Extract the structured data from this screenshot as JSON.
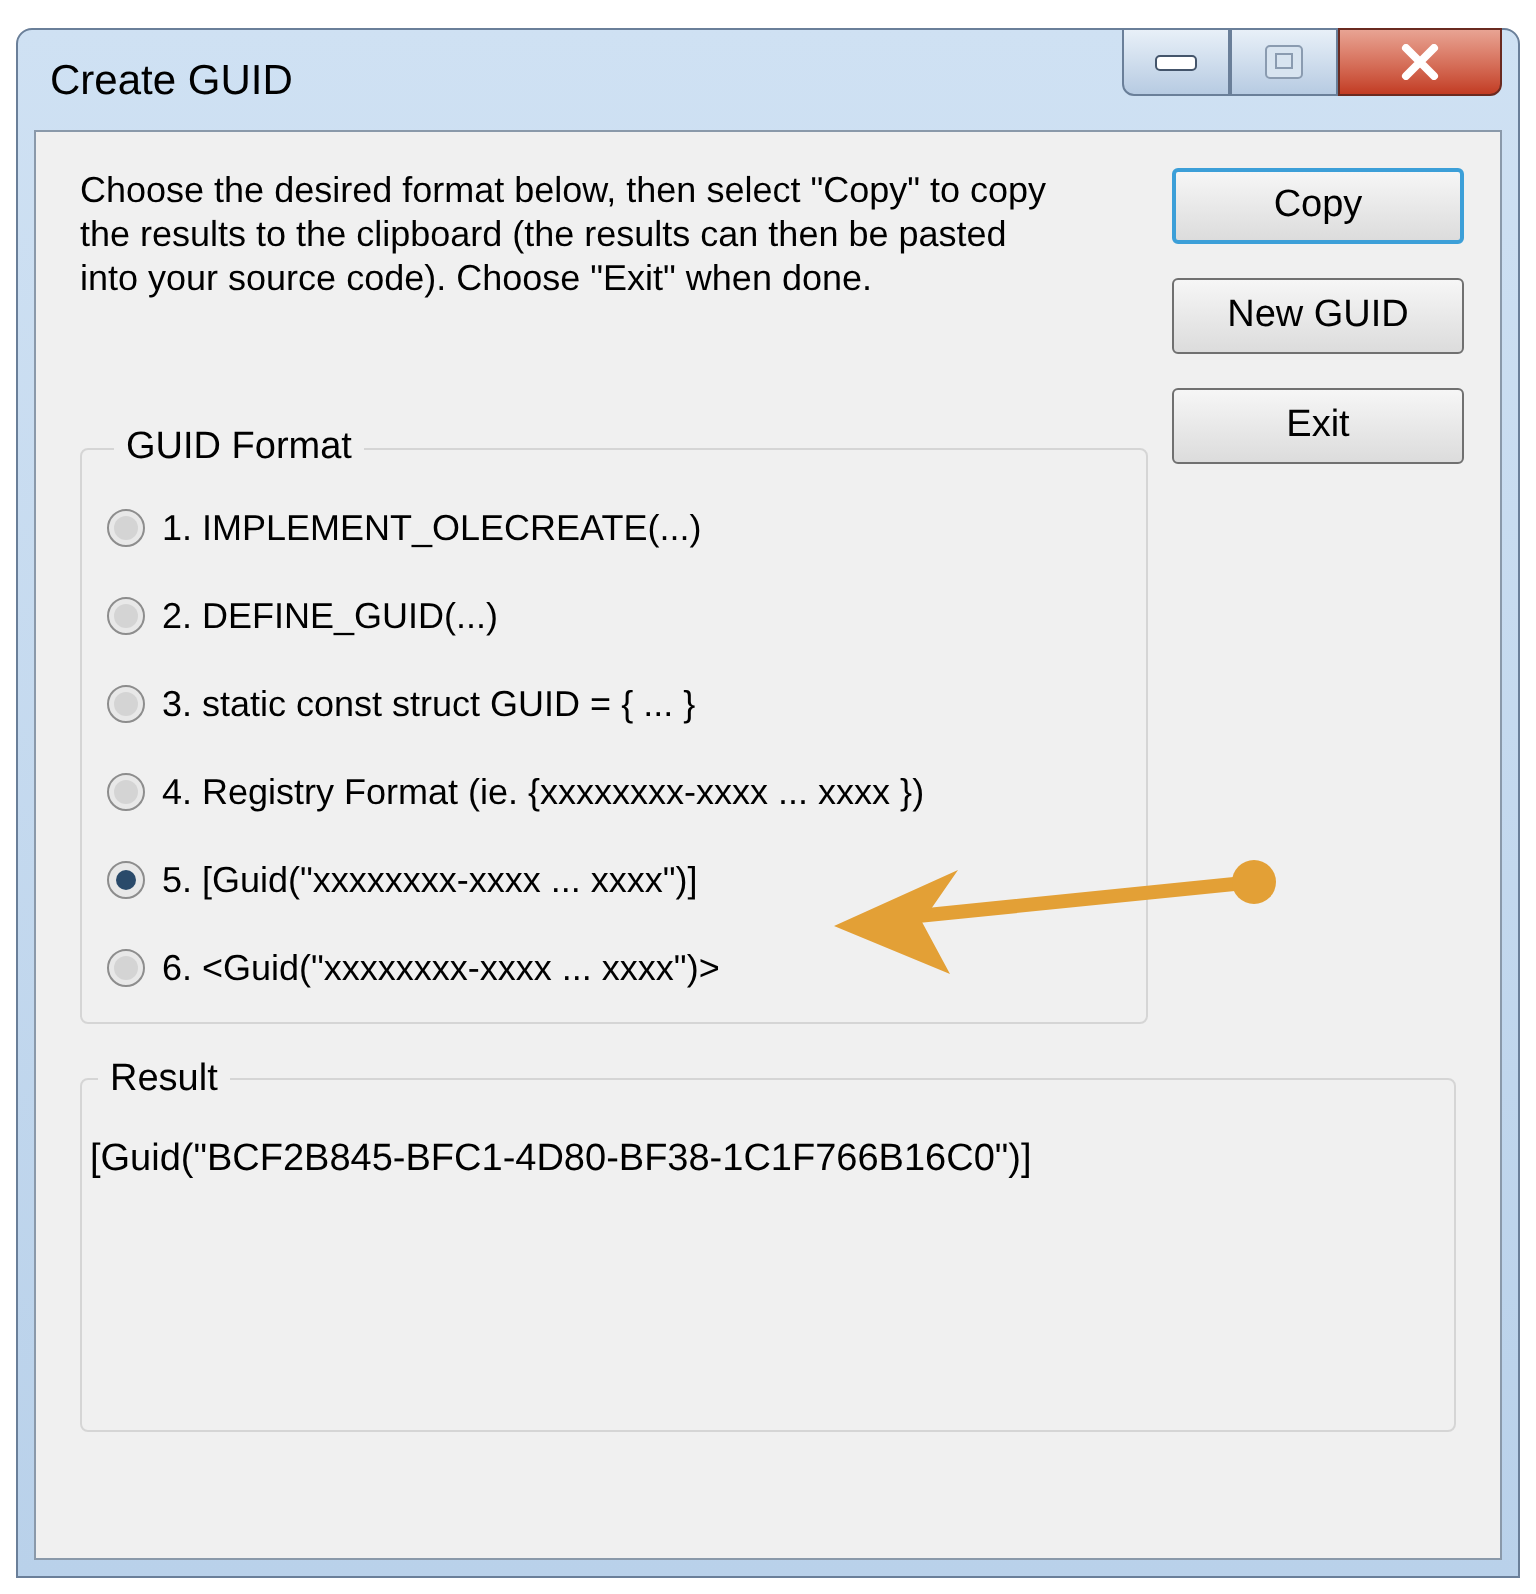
{
  "window": {
    "title": "Create GUID"
  },
  "instructions": "Choose the desired format below, then select \"Copy\" to copy the results to the clipboard (the results can then be pasted into your source code).  Choose \"Exit\" when done.",
  "buttons": [
    {
      "label": "Copy",
      "default": true
    },
    {
      "label": "New GUID",
      "default": false
    },
    {
      "label": "Exit",
      "default": false
    }
  ],
  "guid_format": {
    "title": "GUID Format",
    "options": [
      {
        "label": "1. IMPLEMENT_OLECREATE(...)",
        "selected": false
      },
      {
        "label": "2. DEFINE_GUID(...)",
        "selected": false
      },
      {
        "label": "3. static const struct GUID = { ... }",
        "selected": false
      },
      {
        "label": "4. Registry Format (ie. {xxxxxxxx-xxxx ... xxxx })",
        "selected": false
      },
      {
        "label": "5. [Guid(\"xxxxxxxx-xxxx ... xxxx\")]",
        "selected": true
      },
      {
        "label": "6. <Guid(\"xxxxxxxx-xxxx ... xxxx\")>",
        "selected": false
      }
    ]
  },
  "result": {
    "title": "Result",
    "value": "[Guid(\"BCF2B845-BFC1-4D80-BF38-1C1F766B16C0\")]"
  }
}
